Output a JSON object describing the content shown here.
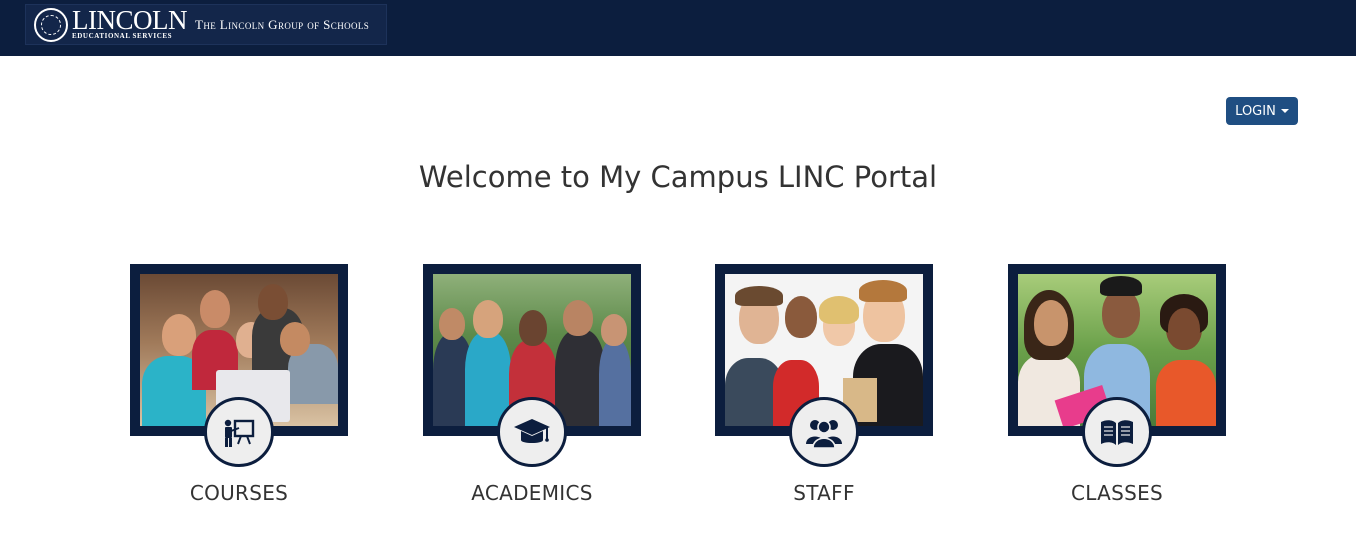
{
  "header": {
    "brand_name": "LINCOLN",
    "brand_sub": "Educational Services",
    "brand_tagline": "The Lincoln Group of Schools"
  },
  "login": {
    "label": "LOGIN"
  },
  "welcome": "Welcome to My Campus LINC Portal",
  "tiles": [
    {
      "label": "COURSES",
      "icon": "presentation-icon"
    },
    {
      "label": "ACADEMICS",
      "icon": "graduation-cap-icon"
    },
    {
      "label": "STAFF",
      "icon": "people-icon"
    },
    {
      "label": "CLASSES",
      "icon": "book-icon"
    }
  ],
  "colors": {
    "navbar": "#0c1e3e",
    "login_button": "#1f4e82",
    "tile_frame": "#0c1e3e",
    "badge_bg": "#eeeeee"
  }
}
